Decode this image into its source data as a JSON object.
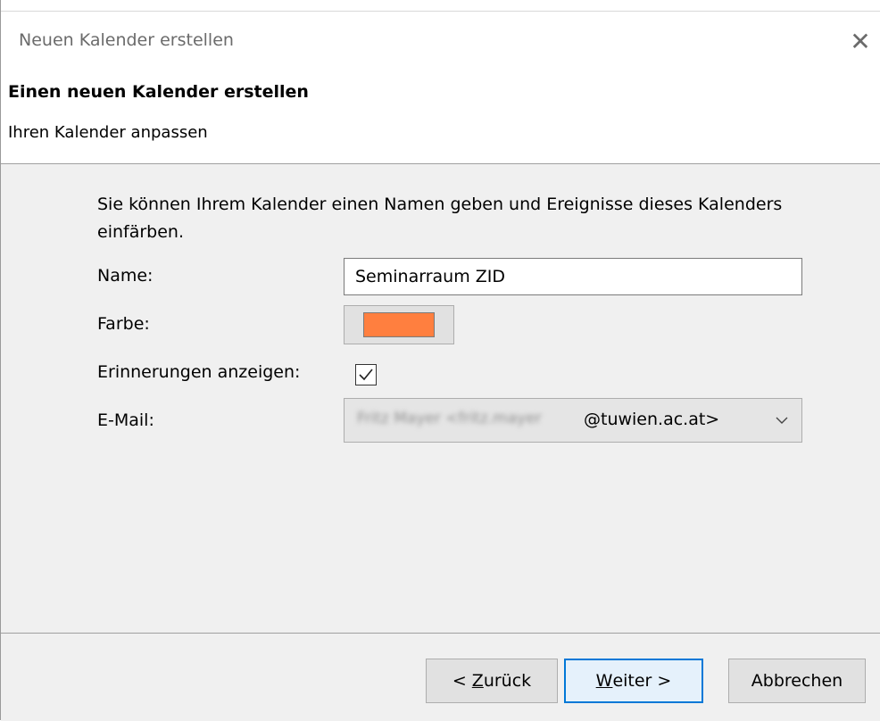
{
  "window": {
    "title": "Neuen Kalender erstellen",
    "close_glyph": "✕"
  },
  "header": {
    "title": "Einen neuen Kalender erstellen",
    "subtitle": "Ihren Kalender anpassen"
  },
  "form": {
    "intro": "Sie können Ihrem Kalender einen Namen geben und Ereignisse dieses Kalenders einfärben.",
    "name_label": "Name:",
    "name_value": "Seminarraum ZID",
    "color_label": "Farbe:",
    "color_value": "#ff7f3f",
    "reminders_label": "Erinnerungen anzeigen:",
    "reminders_checked": true,
    "email_label": "E-Mail:",
    "email_blurred": "Fritz Mayer <fritz.mayer",
    "email_domain": "@tuwien.ac.at>"
  },
  "footer": {
    "back_prefix": "< ",
    "back_mnemonic": "Z",
    "back_rest": "urück",
    "next_mnemonic": "W",
    "next_rest": "eiter >",
    "cancel_label": "Abbrechen"
  },
  "icons": {
    "close": "close-icon",
    "check": "checkmark-icon",
    "dropdown": "chevron-down-icon"
  },
  "colors": {
    "accent": "#0078d7",
    "calendar_color": "#ff7f3f"
  }
}
